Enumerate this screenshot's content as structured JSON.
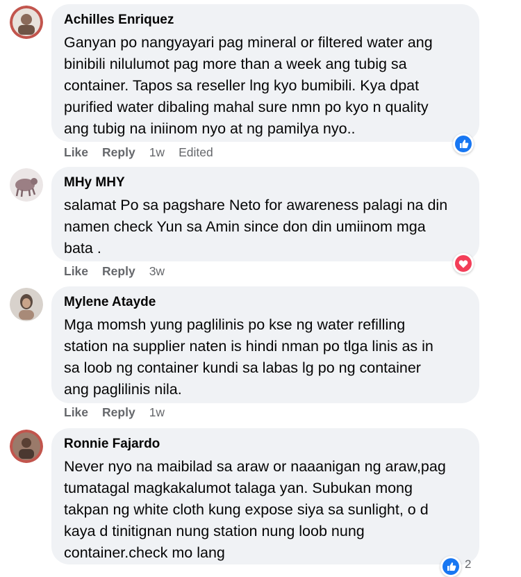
{
  "colors": {
    "bubble_bg": "#f0f2f5",
    "meta_text": "#65676b",
    "like_blue": "#1877f2",
    "love_red": "#f33e58"
  },
  "comments": [
    {
      "author": "Achilles Enriquez",
      "text": "Ganyan po nangyayari pag mineral or filtered water ang\nbinibili nilulumot pag more than a week ang tubig sa\ncontainer. Tapos sa reseller lng kyo bumibili. Kya dpat\npurified water dibaling mahal sure nmn po kyo n quality\nang tubig na iniinom nyo at ng pamilya nyo..",
      "like": "Like",
      "reply": "Reply",
      "time": "1w",
      "edited": "Edited",
      "reaction": "like-icon"
    },
    {
      "author": "MHy MHY",
      "text": "salamat Po sa pagshare Neto for awareness palagi na din\nnamen check Yun sa Amin since don din umiinom mga\nbata .",
      "like": "Like",
      "reply": "Reply",
      "time": "3w",
      "reaction": "love-icon"
    },
    {
      "author": "Mylene Atayde",
      "text": "Mga momsh yung paglilinis po kse ng water refilling\nstation na supplier naten is hindi nman po tlga linis as in\nsa loob ng container kundi sa labas lg po ng container\nang paglilinis nila.",
      "like": "Like",
      "reply": "Reply",
      "time": "1w"
    },
    {
      "author": "Ronnie Fajardo",
      "text": "Never nyo na maibilad sa araw or naaanigan ng araw,pag\ntumatagal magkakalumot talaga yan. Subukan mong\ntakpan ng white cloth kung expose siya sa sunlight, o d\nkaya d tinitignan nung station nung loob nung\ncontainer.check mo lang",
      "reaction": "like-icon",
      "reaction_count": "2"
    }
  ]
}
